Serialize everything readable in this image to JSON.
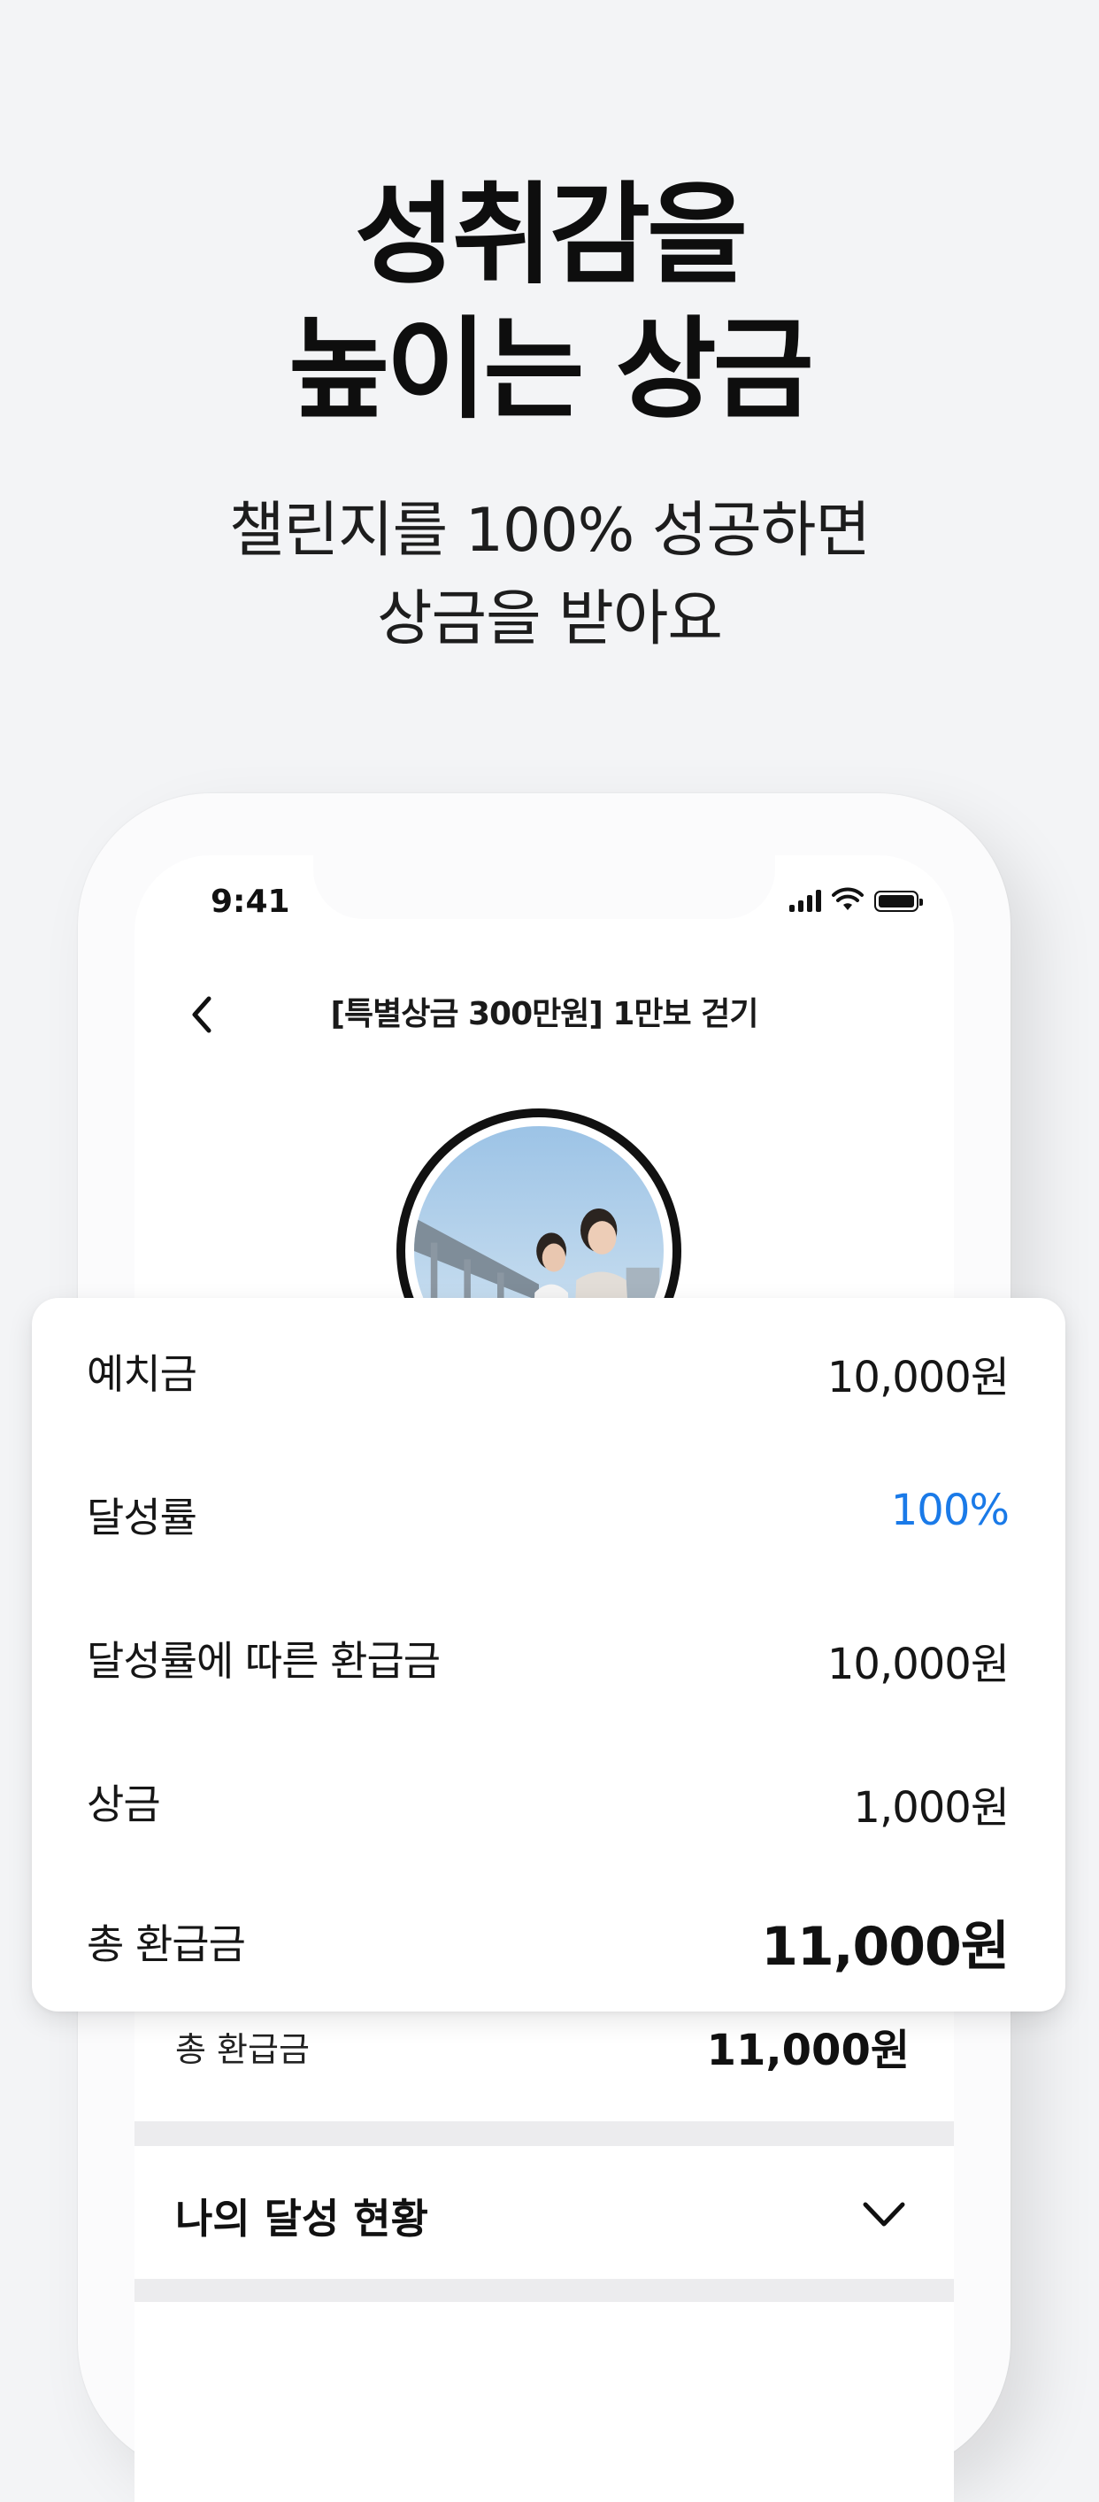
{
  "headline": {
    "line1": "성취감을",
    "line2": "높이는 상금"
  },
  "subline": {
    "line1": "챌린지를 100% 성공하면",
    "line2": "상금을 받아요"
  },
  "status_bar": {
    "time": "9:41"
  },
  "nav": {
    "title": "[특별상금 300만원] 1만보 걷기"
  },
  "summary_card": {
    "rows": [
      {
        "label": "예치금",
        "value": "10,000원"
      },
      {
        "label": "달성률",
        "value": "100%"
      },
      {
        "label": "달성률에 따른 환급금",
        "value": "10,000원"
      },
      {
        "label": "상금",
        "value": "1,000원"
      },
      {
        "label": "총 환급금",
        "value": "11,000원"
      }
    ]
  },
  "screen_total": {
    "label": "총 환급금",
    "value": "11,000원"
  },
  "my_status": {
    "label": "나의 달성 현황"
  },
  "colors": {
    "accent": "#1a7ae8",
    "background": "#f3f4f6",
    "text": "#111111"
  }
}
